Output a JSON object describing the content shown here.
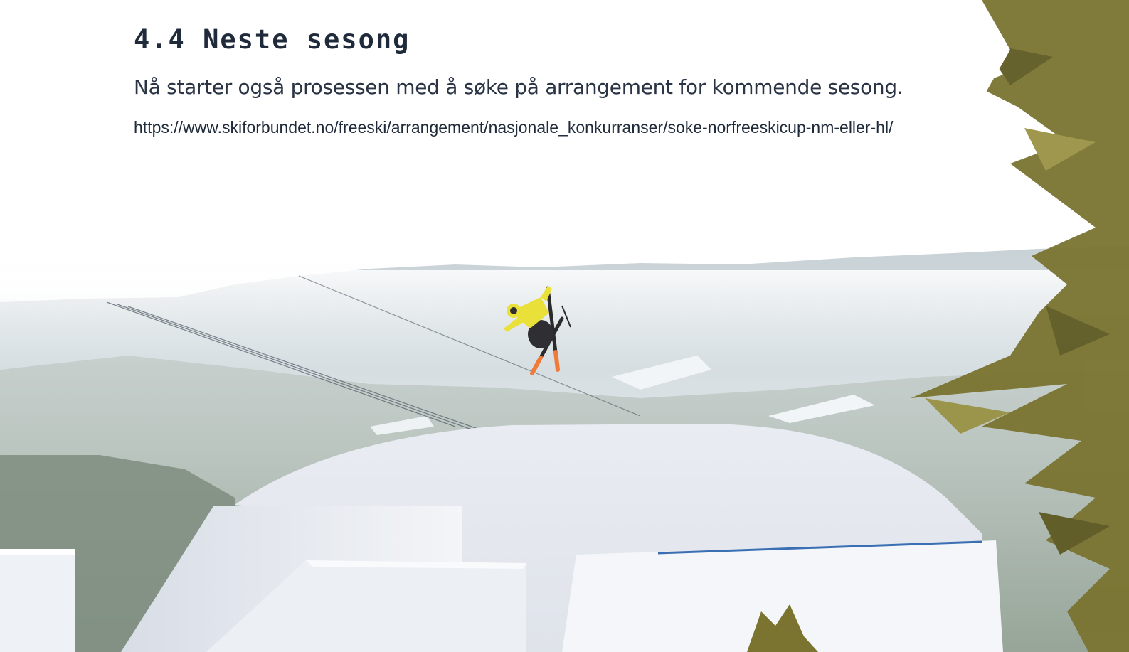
{
  "section": {
    "heading": "4.4 Neste sesong",
    "intro": "Nå starter også prosessen med å søke på arrangement for kommende sesong.",
    "link_text": "https://www.skiforbundet.no/freeski/arrangement/nasjonale_konkurranser/soke-norfreeskicup-nm-eller-hl/",
    "link_href": "https://www.skiforbundet.no/freeski/arrangement/nasjonale_konkurranser/soke-norfreeskicup-nm-eller-hl/"
  },
  "colors": {
    "text": "#1f2a3a",
    "sky": "#ffffff",
    "jacket": "#e9e03a",
    "ski_tips": "#f07a3a",
    "snow": "#eef1f5",
    "tree": "#6f6a2a"
  }
}
